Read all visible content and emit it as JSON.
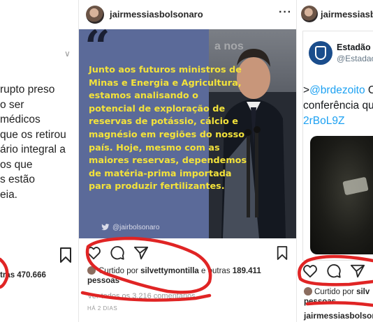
{
  "left_post": {
    "tweet_lines": [
      "rupto preso",
      "o ser",
      " médicos",
      " que os retirou",
      "ário integral a",
      "os que",
      "s estão",
      "eia."
    ],
    "likes_text": "tras 470.666"
  },
  "middle_post": {
    "username": "jairmessiasbolsonaro",
    "quote_lines": [
      "Junto aos futuros ministros de",
      "Minas e Energia e Agricultura,",
      "estamos analisando o",
      "potencial de exploração de",
      "reservas de potássio, cálcio e",
      "magnésio em regiões do nosso",
      "país. Hoje, mesmo com as",
      "maiores reservas, dependemos",
      "de matéria-prima importada",
      "para produzir fertilizantes."
    ],
    "image_handle": "@jairbolsonaro",
    "image_sign_text": "a nos",
    "liked_prefix": "Curtido por",
    "liked_user": "silvettymontilla",
    "liked_mid": "e outras",
    "liked_count": "189.411",
    "liked_suffix": "pessoas",
    "comments_text": "Ver todos os 3.216 comentários",
    "date_text": "HÁ 2 DIAS"
  },
  "right_post": {
    "username": "jairmessiasbolsonaro",
    "account_name": "Estadão",
    "account_handle": "@Estadao",
    "tweet_lines": [
      ">@brdezoito C",
      "conferência qu",
      "2rBoL9Z"
    ],
    "tweet_mention": "@brdezoito",
    "liked_prefix": "Curtido por",
    "liked_user": "silv",
    "liked_suffix": "pessoas",
    "bottom_username": "jairmessiasbolsonaro"
  },
  "colors": {
    "annotation": "#e02424",
    "quote_text": "#f3e23a",
    "twitter_blue": "#1da1f2",
    "estadao_blue": "#1a4d8c"
  },
  "icons": [
    "heart-icon",
    "comment-icon",
    "share-icon",
    "bookmark-icon",
    "more-options-icon",
    "twitter-bird-icon",
    "verified-icon"
  ]
}
